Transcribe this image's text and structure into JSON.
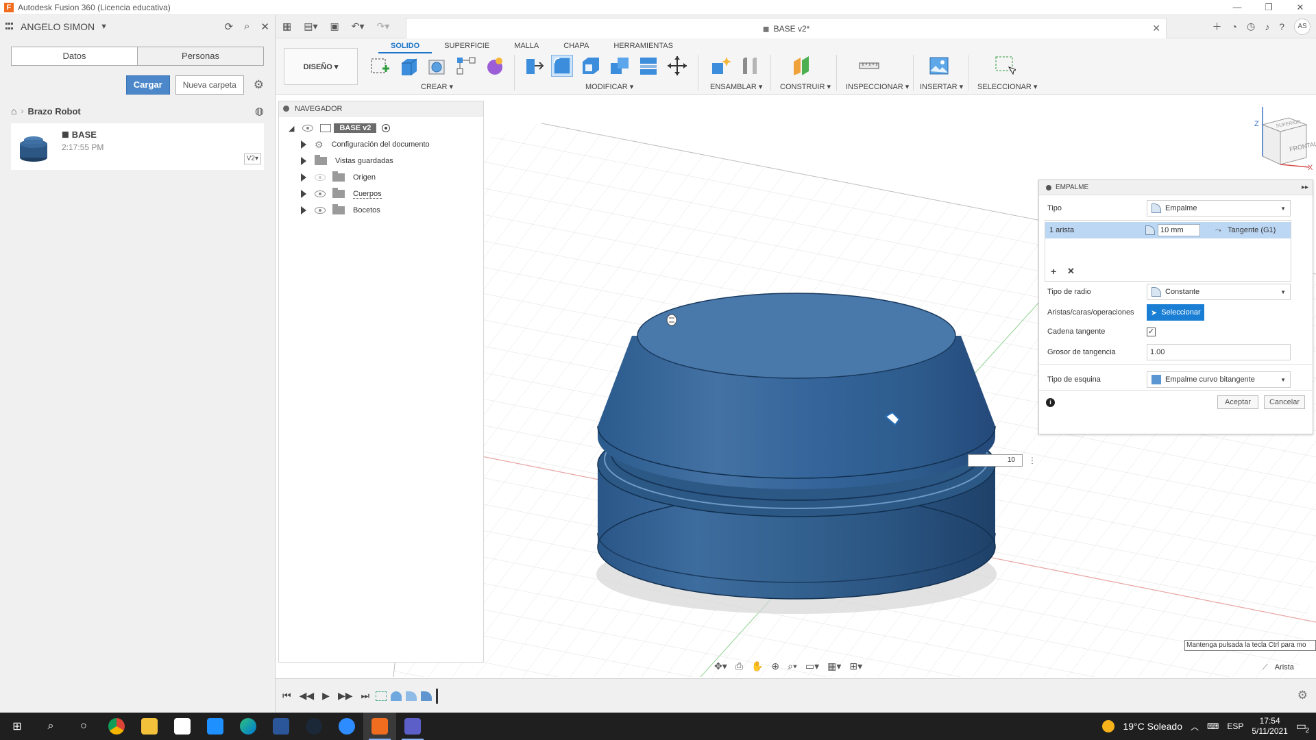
{
  "window": {
    "title": "Autodesk Fusion 360 (Licencia educativa)",
    "logo_letter": "F"
  },
  "data_panel": {
    "user_name": "ANGELO SIMON",
    "tabs": [
      "Datos",
      "Personas"
    ],
    "upload_label": "Cargar",
    "new_folder_label": "Nueva carpeta",
    "breadcrumb_project": "Brazo Robot",
    "file": {
      "name": "BASE",
      "time": "2:17:55 PM",
      "version": "V2"
    }
  },
  "app_header": {
    "document_tab": "BASE v2*",
    "avatar_initials": "AS"
  },
  "ribbon": {
    "workspace_label": "DISEÑO ▾",
    "tabs": [
      "SOLIDO",
      "SUPERFICIE",
      "MALLA",
      "CHAPA",
      "HERRAMIENTAS"
    ],
    "groups": [
      "CREAR ▾",
      "MODIFICAR ▾",
      "ENSAMBLAR ▾",
      "CONSTRUIR ▾",
      "INSPECCIONAR ▾",
      "INSERTAR ▾",
      "SELECCIONAR ▾"
    ]
  },
  "navigator": {
    "title": "NAVEGADOR",
    "root": "BASE v2",
    "items": [
      "Configuración del documento",
      "Vistas guardadas",
      "Origen",
      "Cuerpos",
      "Bocetos"
    ]
  },
  "viewcube": {
    "top": "SUPERIOR",
    "front": "FRONTAL",
    "axis_z": "Z",
    "axis_x": "X"
  },
  "fillet_panel": {
    "title": "EMPALME",
    "type_label": "Tipo",
    "type_value": "Empalme",
    "edge_selection": "1 arista",
    "radius_value": "10 mm",
    "continuity": "Tangente (G1)",
    "radius_type_label": "Tipo de radio",
    "radius_type_value": "Constante",
    "edges_label": "Aristas/caras/operaciones",
    "select_button": "Seleccionar",
    "tangent_chain_label": "Cadena tangente",
    "tangency_weight_label": "Grosor de tangencia",
    "tangency_weight_value": "1.00",
    "corner_type_label": "Tipo de esquina",
    "corner_type_value": "Empalme curvo bitangente",
    "ok_label": "Aceptar",
    "cancel_label": "Cancelar"
  },
  "viewport": {
    "radius_input_value": "10",
    "tooltip": "Mantenga pulsada la tecla Ctrl para mo",
    "selection_filter": "Arista"
  },
  "taskbar": {
    "weather": "19°C  Soleado",
    "language": "ESP",
    "time": "17:54",
    "date": "5/11/2021",
    "notification_count": "2"
  }
}
